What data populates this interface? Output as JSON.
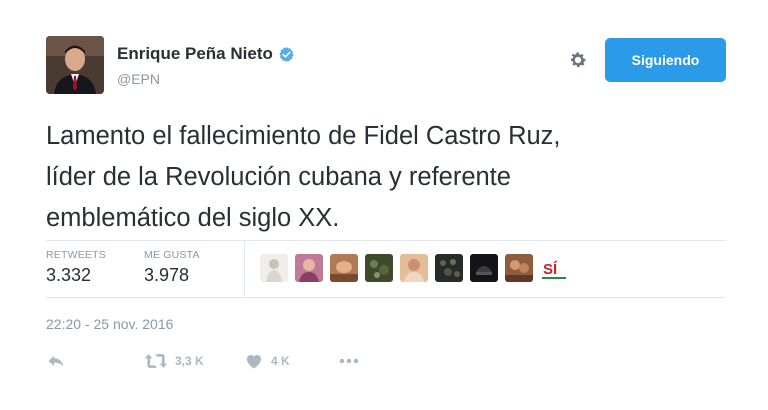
{
  "user": {
    "name": "Enrique Peña Nieto",
    "handle": "@EPN",
    "verified": true,
    "avatar_icon": "profile-photo"
  },
  "follow_button": {
    "label": "Siguiendo",
    "color": "#2b9ae8"
  },
  "settings_icon": "gear-icon",
  "tweet": {
    "text_lines": [
      "Lamento el fallecimiento de Fidel Castro Ruz,",
      "líder de la Revolución cubana y referente",
      "emblemático del siglo XX."
    ]
  },
  "stats": {
    "retweets_label": "RETWEETS",
    "retweets_value": "3.332",
    "likes_label": "ME GUSTA",
    "likes_value": "3.978"
  },
  "likers": [
    {
      "name": "liker-avatar-1",
      "color": "#e8e2dc"
    },
    {
      "name": "liker-avatar-2",
      "color": "#b86a8a"
    },
    {
      "name": "liker-avatar-3",
      "color": "#c98f68"
    },
    {
      "name": "liker-avatar-4",
      "color": "#4f5c3a"
    },
    {
      "name": "liker-avatar-5",
      "color": "#d9a884"
    },
    {
      "name": "liker-avatar-6",
      "color": "#2f3530"
    },
    {
      "name": "liker-avatar-7",
      "color": "#1d1d1f"
    },
    {
      "name": "liker-avatar-8",
      "color": "#9c6848"
    },
    {
      "name": "liker-avatar-9",
      "color": "#ffffff"
    }
  ],
  "liker_badge_text": "SÍ",
  "timestamp": "22:20 - 25 nov. 2016",
  "actions": {
    "reply_icon": "reply-icon",
    "retweet_icon": "retweet-icon",
    "retweet_count": "3,3 K",
    "like_icon": "heart-icon",
    "like_count": "4 K",
    "more_icon": "more-icon"
  }
}
